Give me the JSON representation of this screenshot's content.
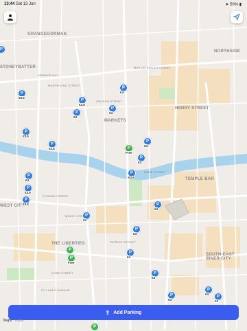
{
  "status_bar": {
    "time": "13:44",
    "date": "Sat 13 Jun",
    "right": "➤ 59% ▮"
  },
  "map": {
    "areas": [
      {
        "id": "grangegorman",
        "text": "GRANGEGORMAN"
      },
      {
        "id": "stoneybatter",
        "text": "STONEYBATTER"
      },
      {
        "id": "northside",
        "text": "NORTHSIDE"
      },
      {
        "id": "markets",
        "text": "MARKETS"
      },
      {
        "id": "henry",
        "text": "HENRY STREET"
      },
      {
        "id": "templebar",
        "text": "TEMPLE BAR"
      },
      {
        "id": "westcity",
        "text": "WEST CITY"
      },
      {
        "id": "liberties",
        "text": "THE LIBERTIES"
      },
      {
        "id": "southeast",
        "text": "SOUTH-EAST INNER CITY"
      }
    ],
    "streets": [
      {
        "id": "s1",
        "text": "ARBOUR HILL"
      },
      {
        "id": "s2",
        "text": "NORTH KING STREET"
      },
      {
        "id": "s3",
        "text": "MARLBOROUGH STREET"
      },
      {
        "id": "s4",
        "text": "CHURCH STREET"
      },
      {
        "id": "s5",
        "text": "THOMAS STREET"
      },
      {
        "id": "s6",
        "text": "MEATH STREET"
      },
      {
        "id": "s7",
        "text": "PATRICK STREET"
      },
      {
        "id": "s8",
        "text": "DAME STREET"
      },
      {
        "id": "s9",
        "text": "CORK STREET"
      },
      {
        "id": "s10",
        "text": "ST LUKE'S AVENUE"
      }
    ]
  },
  "pins": [
    {
      "kind": "paid",
      "icon": "P",
      "price": ""
    },
    {
      "kind": "paid",
      "icon": "P",
      "price": "€3.5"
    },
    {
      "kind": "paid",
      "icon": "P",
      "price": "€4"
    },
    {
      "kind": "paid",
      "icon": "P",
      "price": "€3.5"
    },
    {
      "kind": "paid",
      "icon": "P",
      "price": "€4"
    },
    {
      "kind": "paid",
      "icon": "P",
      "price": "€4"
    },
    {
      "kind": "paid",
      "icon": "P",
      "price": "€3.5"
    },
    {
      "kind": "paid",
      "icon": "P",
      "price": "€3.5"
    },
    {
      "kind": "free",
      "icon": "P",
      "price": "Free"
    },
    {
      "kind": "paid",
      "icon": "P",
      "price": "€4"
    },
    {
      "kind": "paid",
      "icon": "P",
      "price": "€4"
    },
    {
      "kind": "paid",
      "icon": "P",
      "price": "€3.5"
    },
    {
      "kind": "paid",
      "icon": "P",
      "price": "€4"
    },
    {
      "kind": "paid",
      "icon": "P",
      "price": "€3.5"
    },
    {
      "kind": "paid",
      "icon": "P",
      "price": "€3.5"
    },
    {
      "kind": "paid",
      "icon": "P",
      "price": "€4"
    },
    {
      "kind": "paid",
      "icon": "P",
      "price": "€4"
    },
    {
      "kind": "paid",
      "icon": "P",
      "price": "€4"
    },
    {
      "kind": "free",
      "icon": "P",
      "price": ""
    },
    {
      "kind": "free",
      "icon": "P",
      "price": "Free"
    },
    {
      "kind": "paid",
      "icon": "P",
      "price": "€4"
    },
    {
      "kind": "paid",
      "icon": "P",
      "price": "€4"
    },
    {
      "kind": "paid",
      "icon": "P",
      "price": "€4"
    },
    {
      "kind": "paid",
      "icon": "P",
      "price": "€4"
    },
    {
      "kind": "paid",
      "icon": "P",
      "price": "€4"
    },
    {
      "kind": "free",
      "icon": "P",
      "price": ""
    }
  ],
  "colors": {
    "water": "#a7d3ec",
    "accent": "#3a5df0",
    "paid": "#2f7de1",
    "free": "#3eb24c"
  },
  "bottom": {
    "button": "Add Parking",
    "button_icon": "⇪",
    "maps_credit": "Maps",
    "legal": "Legal"
  }
}
